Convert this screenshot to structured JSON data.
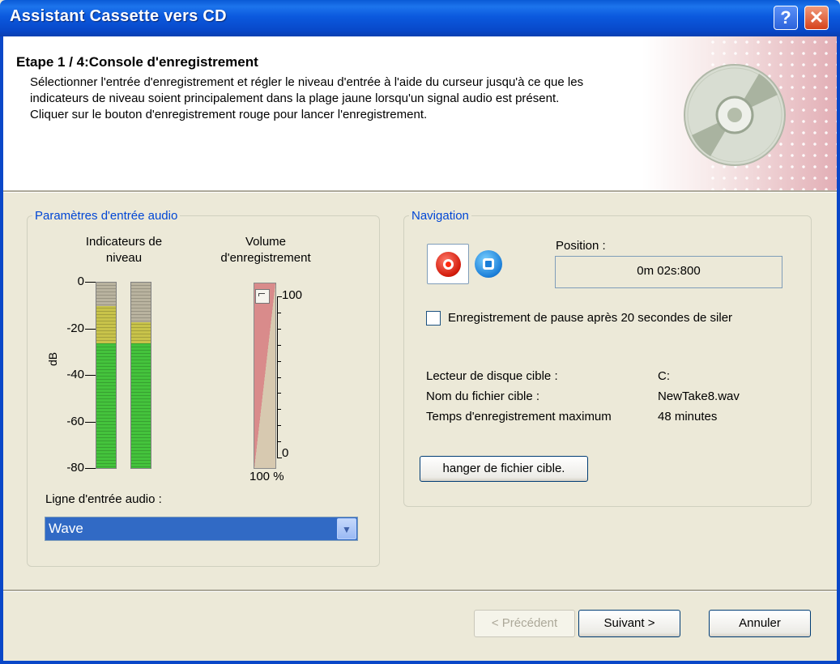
{
  "window": {
    "title": "Assistant Cassette vers CD",
    "help_label": "?",
    "close_label": "✕"
  },
  "header": {
    "step_title": "Etape 1 / 4:Console d'enregistrement",
    "description": "Sélectionner l'entrée d'enregistrement et régler le niveau d'entrée à l'aide du curseur jusqu'à ce que les indicateurs de niveau soient principalement dans la plage jaune lorsqu'un signal audio est présent. Cliquer sur le bouton d'enregistrement rouge pour lancer l'enregistrement."
  },
  "audio_group": {
    "legend": "Paramètres d'entrée audio",
    "meters_label_line1": "Indicateurs de",
    "meters_label_line2": "niveau",
    "volume_label_line1": "Volume",
    "volume_label_line2": "d'enregistrement",
    "db_unit": "dB",
    "db_ticks": [
      "0",
      "-20",
      "-40",
      "-60",
      "-80"
    ],
    "meter_levels_db": [
      -26,
      -26
    ],
    "meter_peaks_db": [
      -10,
      -17
    ],
    "volume_scale_top": "100",
    "volume_scale_bottom": "0",
    "volume_value": "100 %",
    "volume_level_percent": 100,
    "input_line_label": "Ligne d'entrée audio :",
    "input_line_value": "Wave"
  },
  "navigation": {
    "legend": "Navigation",
    "position_label": "Position :",
    "position_value": "0m 02s:800",
    "pause_checkbox_label": "Enregistrement de pause après 20 secondes de siler",
    "pause_checked": false,
    "target_drive_label": "Lecteur de disque cible :",
    "target_drive_value": "C:",
    "target_file_label": "Nom du fichier cible :",
    "target_file_value": "NewTake8.wav",
    "max_time_label": "Temps d'enregistrement maximum",
    "max_time_value": "48 minutes",
    "change_file_button": "hanger de fichier cible."
  },
  "footer": {
    "previous_button": "< Précédent",
    "next_button": "Suivant >",
    "cancel_button": "Annuler"
  },
  "colors": {
    "title_bar": "#0a5ad6",
    "group_legend": "#0046d5",
    "dialog_bg": "#ece9d8",
    "meter_green": "#44c33c",
    "meter_yellow": "#c8c34a",
    "record_red": "#d21a0a"
  }
}
